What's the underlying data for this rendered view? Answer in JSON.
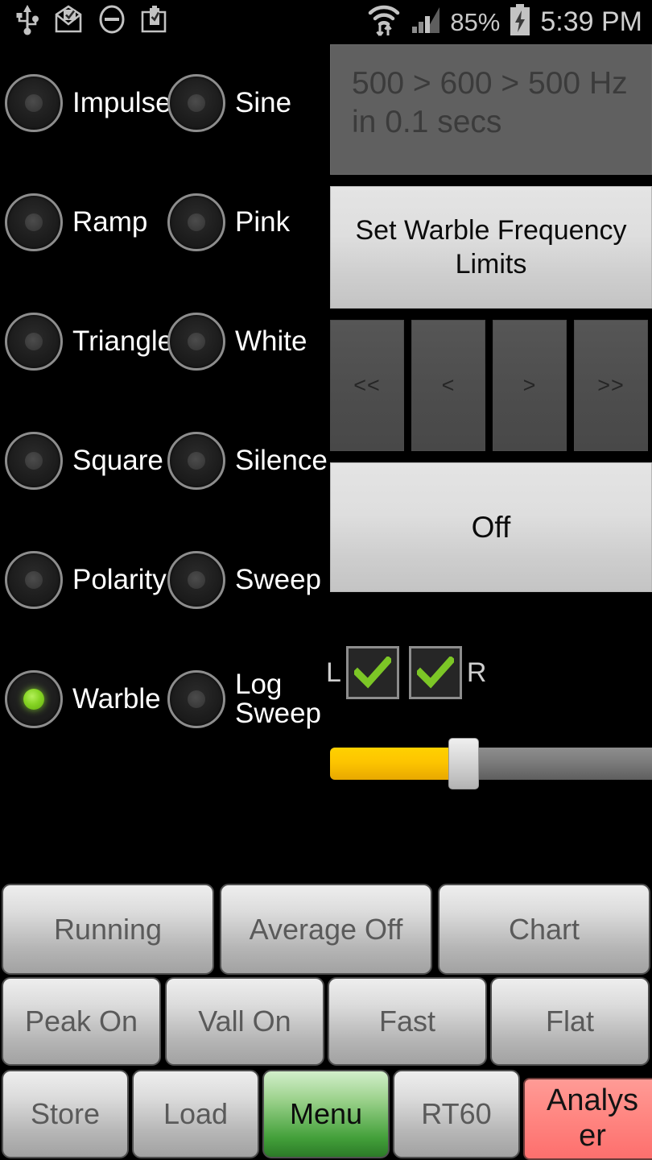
{
  "statusbar": {
    "icons_left": [
      "usb-icon",
      "mail-open-check-icon",
      "do-not-disturb-icon",
      "briefcase-check-icon"
    ],
    "icons_right": [
      "wifi-transfer-icon",
      "cell-signal-icon",
      "battery-charging-icon"
    ],
    "battery_percent": "85%",
    "time": "5:39 PM"
  },
  "generator": {
    "rows": [
      {
        "left": {
          "label": "Impulse",
          "selected": false
        },
        "right": {
          "label": "Sine",
          "selected": false
        }
      },
      {
        "left": {
          "label": "Ramp",
          "selected": false
        },
        "right": {
          "label": "Pink",
          "selected": false
        }
      },
      {
        "left": {
          "label": "Triangle",
          "selected": false
        },
        "right": {
          "label": "White",
          "selected": false
        }
      },
      {
        "left": {
          "label": "Square",
          "selected": false
        },
        "right": {
          "label": "Silence",
          "selected": false
        }
      },
      {
        "left": {
          "label": "Polarity",
          "selected": false
        },
        "right": {
          "label": "Sweep",
          "selected": false
        }
      },
      {
        "left": {
          "label": "Warble",
          "selected": true
        },
        "right": {
          "label": "Log\nSweep",
          "selected": false
        }
      }
    ],
    "selected_signal": "Warble",
    "selected_color": "#86d424"
  },
  "panel": {
    "readout": "500 > 600 > 500 Hz\nin 0.1 secs",
    "warble_limits_label": "Set Warble Frequency Limits",
    "nav_buttons": [
      "<<",
      "<",
      ">",
      ">>"
    ],
    "output_toggle_label": "Off",
    "channels": {
      "left_label": "L",
      "right_label": "R",
      "left_checked": true,
      "right_checked": true,
      "check_color": "#7cc626"
    },
    "level_slider": {
      "value_percent": 40,
      "fill_color": "#fdc500"
    }
  },
  "bottom_bars": {
    "row1": [
      {
        "label": "Running",
        "style": "gray"
      },
      {
        "label": "Average Off",
        "style": "gray"
      },
      {
        "label": "Chart",
        "style": "gray"
      }
    ],
    "row2": [
      {
        "label": "Peak On",
        "style": "gray"
      },
      {
        "label": "Vall On",
        "style": "gray"
      },
      {
        "label": "Fast",
        "style": "gray"
      },
      {
        "label": "Flat",
        "style": "gray"
      }
    ],
    "row3": [
      {
        "label": "Store",
        "style": "gray"
      },
      {
        "label": "Load",
        "style": "gray"
      },
      {
        "label": "Menu",
        "style": "green"
      },
      {
        "label": "RT60",
        "style": "gray"
      },
      {
        "label": "Analys\ner",
        "style": "pink"
      }
    ]
  }
}
